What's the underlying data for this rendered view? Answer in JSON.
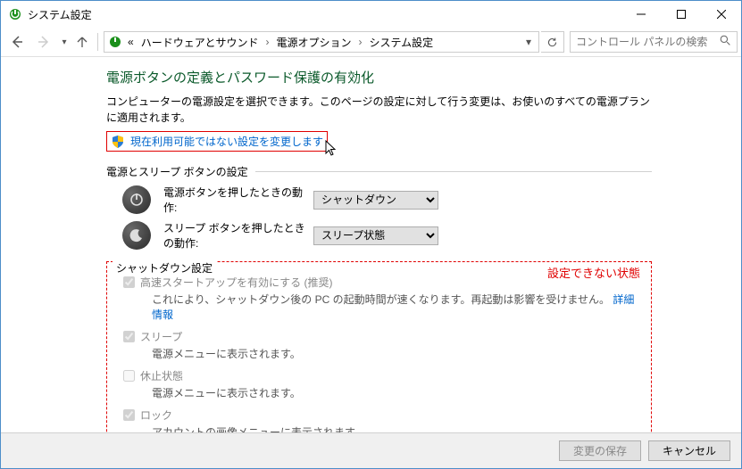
{
  "window": {
    "title": "システム設定"
  },
  "breadcrumb": {
    "items": [
      "ハードウェアとサウンド",
      "電源オプション",
      "システム設定"
    ]
  },
  "search": {
    "placeholder": "コントロール パネルの検索"
  },
  "main": {
    "heading": "電源ボタンの定義とパスワード保護の有効化",
    "description": "コンピューターの電源設定を選択できます。このページの設定に対して行う変更は、お使いのすべての電源プランに適用されます。",
    "change_unavailable_link": "現在利用可能ではない設定を変更します"
  },
  "button_section": {
    "heading": "電源とスリープ ボタンの設定",
    "rows": [
      {
        "label": "電源ボタンを押したときの動作:",
        "value": "シャットダウン"
      },
      {
        "label": "スリープ ボタンを押したときの動作:",
        "value": "スリープ状態"
      }
    ]
  },
  "shutdown_section": {
    "heading": "シャットダウン設定",
    "annotation": "設定できない状態",
    "items": [
      {
        "label": "高速スタートアップを有効にする (推奨)",
        "checked": true,
        "desc": "これにより、シャットダウン後の PC の起動時間が速くなります。再起動は影響を受けません。",
        "link": "詳細情報"
      },
      {
        "label": "スリープ",
        "checked": true,
        "desc": "電源メニューに表示されます。"
      },
      {
        "label": "休止状態",
        "checked": false,
        "desc": "電源メニューに表示されます。"
      },
      {
        "label": "ロック",
        "checked": true,
        "desc": "アカウントの画像メニューに表示されます。"
      }
    ]
  },
  "footer": {
    "save": "変更の保存",
    "cancel": "キャンセル"
  }
}
